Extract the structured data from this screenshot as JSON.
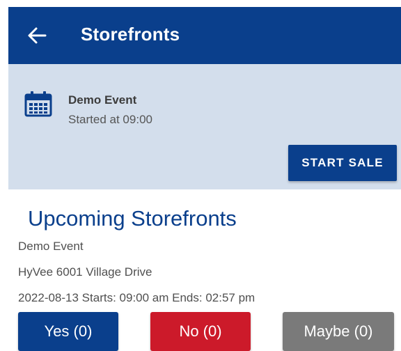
{
  "app_bar": {
    "title": "Storefronts",
    "back_icon": "arrow-left-icon",
    "color": "#0a3f8c"
  },
  "event_card": {
    "icon": "calendar-icon",
    "name": "Demo Event",
    "started": "Started at 09:00",
    "start_sale_label": "START SALE",
    "background": "#d3deec"
  },
  "upcoming": {
    "title": "Upcoming Storefronts",
    "event_name": "Demo Event",
    "location": "HyVee 6001 Village Drive",
    "schedule": "2022-08-13 Starts: 09:00 am Ends: 02:57 pm"
  },
  "responses": {
    "yes_label": "Yes (0)",
    "no_label": "No (0)",
    "maybe_label": "Maybe (0)",
    "yes_color": "#0a3f8c",
    "no_color": "#cc1a2a",
    "maybe_color": "#7a7a7a"
  }
}
